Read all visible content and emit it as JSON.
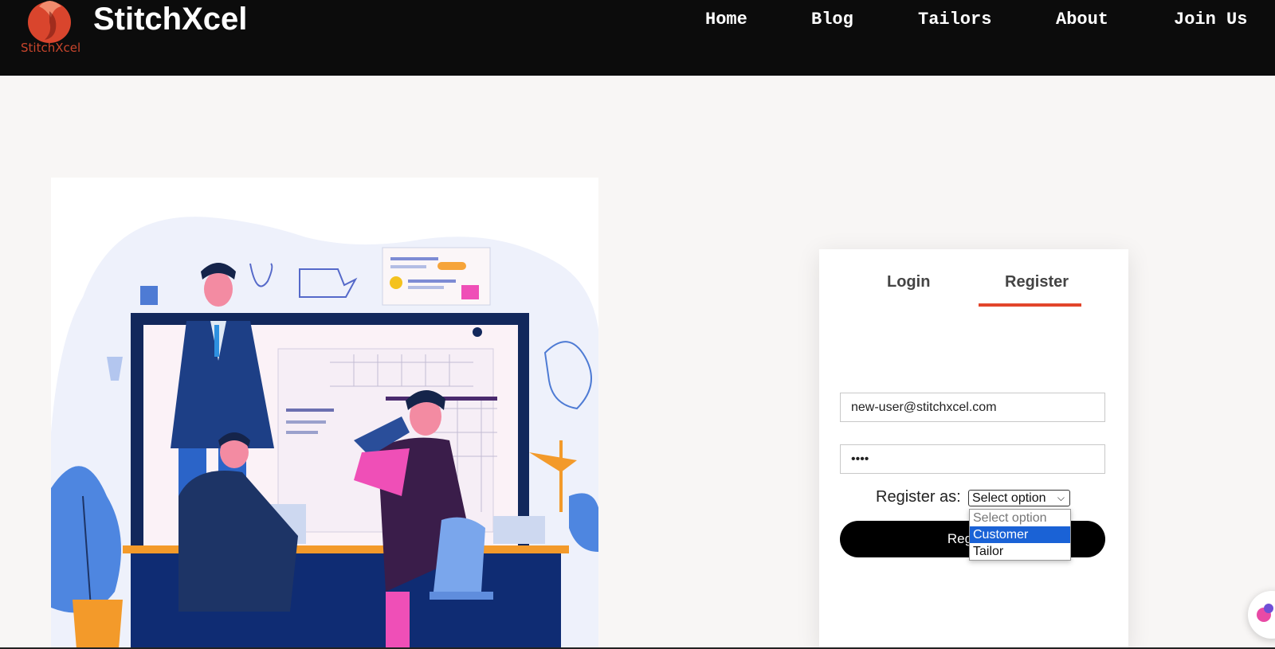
{
  "brand": {
    "name": "StitchXcel",
    "logo_text": "StitchXcel",
    "logo_color": "#c8452c"
  },
  "nav": {
    "items": [
      "Home",
      "Blog",
      "Tailors",
      "About",
      "Join Us"
    ]
  },
  "auth": {
    "tabs": [
      {
        "label": "Login",
        "active": false
      },
      {
        "label": "Register",
        "active": true
      }
    ],
    "accent_color": "#e2452b",
    "email_value": "new-user@stitchxcel.com",
    "password_value": "••••",
    "register_as_label": "Register as:",
    "select_value": "Select option",
    "submit_label": "Register",
    "submit_visible_text": "Reg"
  },
  "dropdown": {
    "options": [
      {
        "label": "Select option",
        "state": "placeholder"
      },
      {
        "label": "Customer",
        "state": "highlighted"
      },
      {
        "label": "Tailor",
        "state": "normal"
      }
    ],
    "highlight_color": "#1a62d6"
  },
  "icons": {
    "chevron": "chevron-down-icon",
    "chat": "chat-widget-icon"
  }
}
